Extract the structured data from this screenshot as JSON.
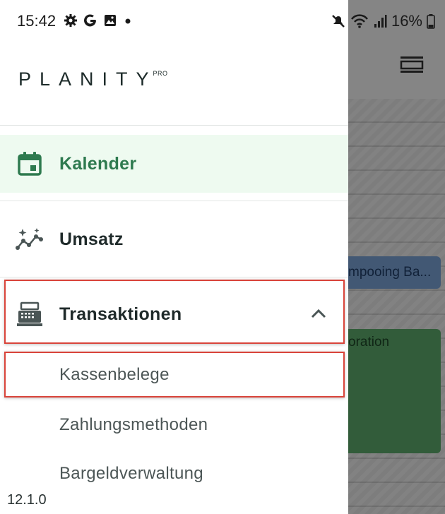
{
  "status_bar": {
    "time": "15:42",
    "battery_text": "16%",
    "left_icons": [
      "gear-icon",
      "google-icon",
      "image-icon",
      "dot-icon"
    ],
    "right_icons": [
      "mute-icon",
      "wifi-icon",
      "signal-icon",
      "battery-icon"
    ]
  },
  "drawer": {
    "logo": {
      "text": "PLANITY",
      "sup": "PRO"
    },
    "items": [
      {
        "label": "Kalender",
        "icon": "calendar-icon",
        "active": true
      },
      {
        "label": "Umsatz",
        "icon": "sparkle-chart-icon"
      },
      {
        "label": "Transaktionen",
        "icon": "cash-register-icon",
        "expanded": true
      }
    ],
    "sub_items": [
      "Kassenbelege",
      "Zahlungsmethoden",
      "Bargeldverwaltung"
    ],
    "version": "12.1.0"
  },
  "background": {
    "event_blue_text": "mpooing Ba...",
    "event_green_text": "oration"
  },
  "colors": {
    "accent_green": "#2e7a4f",
    "active_bg": "#eefaf0",
    "highlight_red": "#d9443a"
  }
}
